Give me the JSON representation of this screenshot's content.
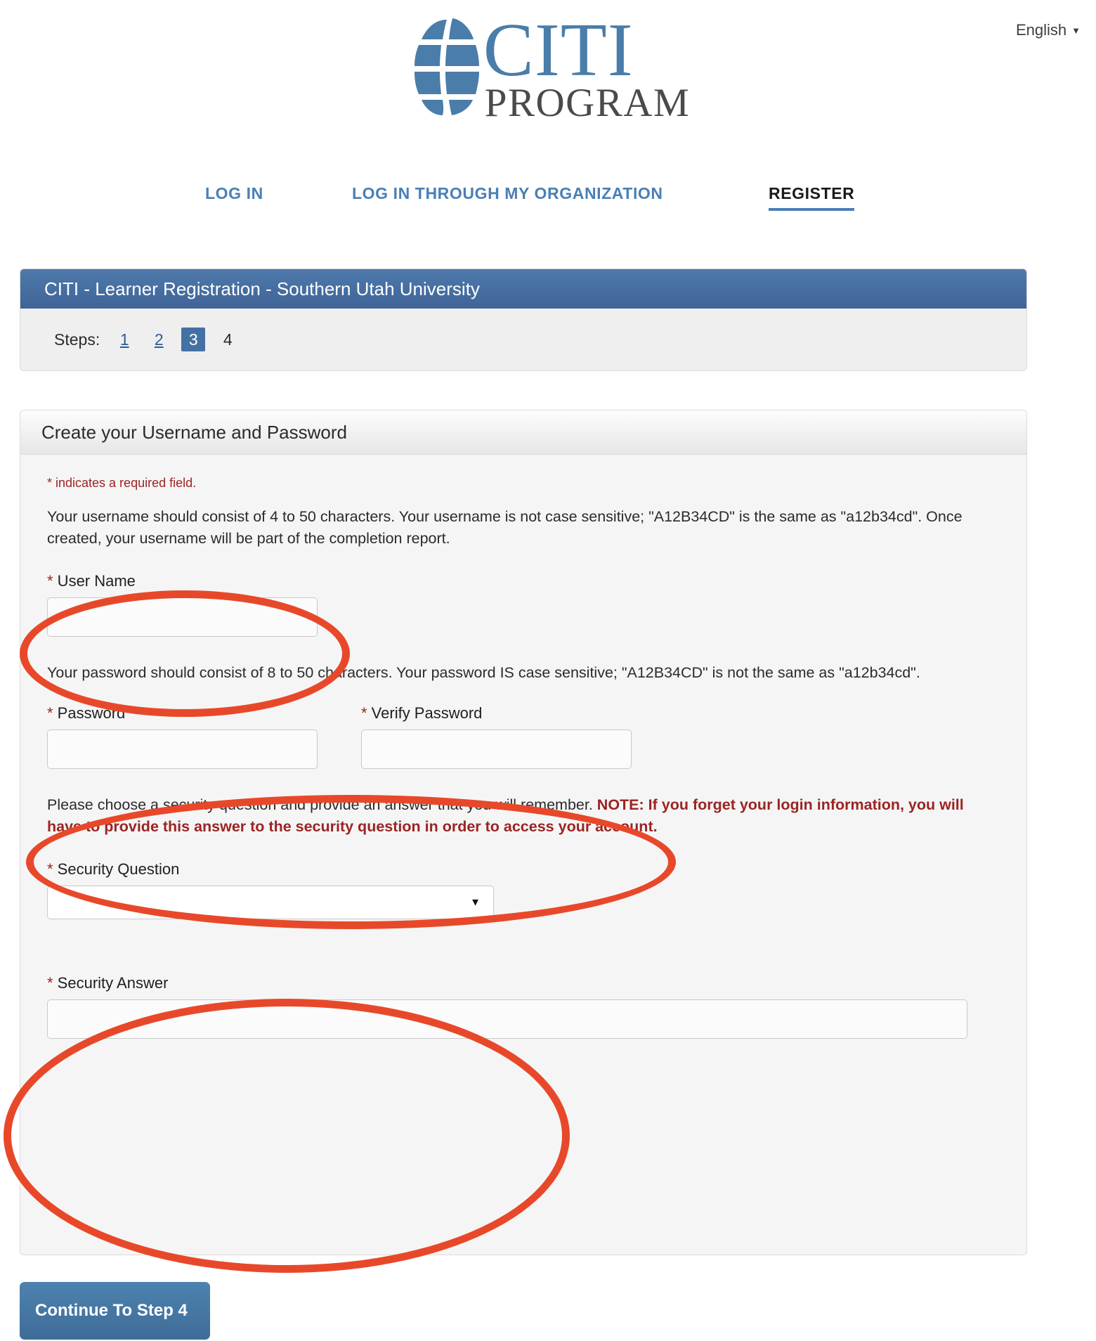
{
  "language_selector": {
    "label": "English",
    "caret_icon": "caret-down-icon"
  },
  "logo": {
    "brand": "CITI",
    "subbrand": "PROGRAM",
    "globe_icon": "globe-icon",
    "brand_color": "#4a7da9",
    "subbrand_color": "#4a4a4a"
  },
  "nav": {
    "login": "LOG IN",
    "login_org": "LOG IN THROUGH MY ORGANIZATION",
    "register": "REGISTER",
    "active": "REGISTER",
    "link_color": "#4a7fb5"
  },
  "steps_panel": {
    "title": "CITI - Learner Registration - Southern Utah University",
    "steps_label": "Steps:",
    "steps": [
      {
        "number": "1",
        "state": "link"
      },
      {
        "number": "2",
        "state": "link"
      },
      {
        "number": "3",
        "state": "active"
      },
      {
        "number": "4",
        "state": "plain"
      }
    ],
    "header_color": "#4471a4"
  },
  "form_panel": {
    "header_title": "Create your Username and Password",
    "required_note": "* indicates a required field.",
    "username_help": "Your username should consist of 4 to 50 characters. Your username is not case sensitive; \"A12B34CD\" is the same as \"a12b34cd\". Once created, your username will be part of the completion report.",
    "password_help": "Your password should consist of 8 to 50 characters. Your password IS case sensitive; \"A12B34CD\" is not the same as \"a12b34cd\".",
    "security_help_plain": "Please choose a security question and provide an answer that you will remember. ",
    "security_help_note": "NOTE: If you forget your login information, you will have to provide this answer to the security question in order to access your account.",
    "fields": {
      "username": {
        "star": "*",
        "label": " User Name",
        "value": "",
        "placeholder": ""
      },
      "password": {
        "star": "*",
        "label": " Password",
        "value": "",
        "placeholder": ""
      },
      "verify_password": {
        "star": "*",
        "label": " Verify Password",
        "value": "",
        "placeholder": ""
      },
      "security_question": {
        "star": "*",
        "label": " Security Question",
        "selected": "",
        "caret_icon": "caret-down-icon"
      },
      "security_answer": {
        "star": "*",
        "label": " Security Answer",
        "value": "",
        "placeholder": ""
      }
    }
  },
  "continue_button": {
    "label": "Continue To Step 4"
  },
  "annotations": {
    "color": "#e8482a",
    "ellipses": [
      {
        "target": "username-field"
      },
      {
        "target": "password-fields"
      },
      {
        "target": "security-fields"
      }
    ]
  }
}
